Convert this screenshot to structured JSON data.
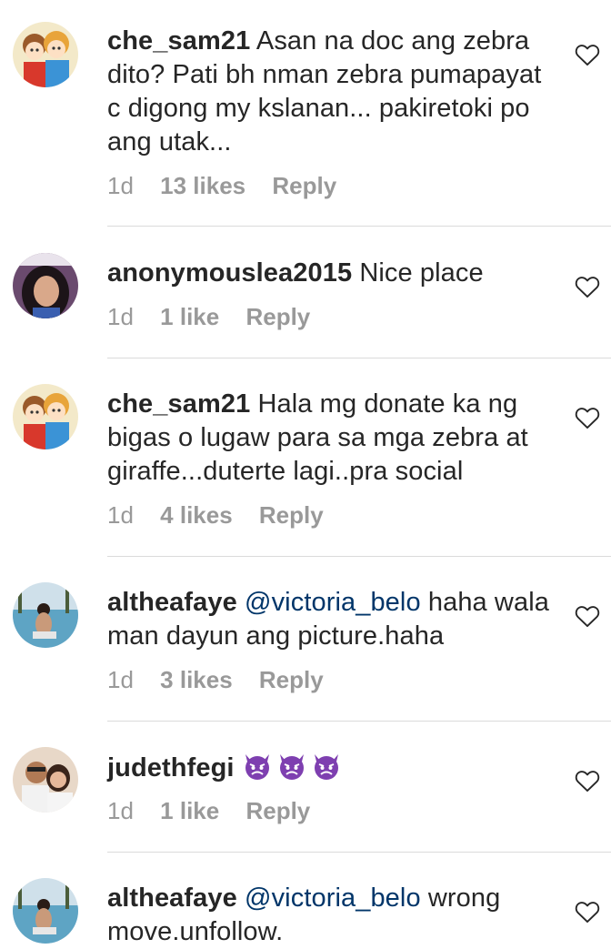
{
  "comments": [
    {
      "username": "che_sam21",
      "text": "Asan na doc ang zebra dito? Pati bh nman zebra pumapayat c digong my kslanan... pakiretoki po ang utak...",
      "time": "1d",
      "likes": "13 likes",
      "reply": "Reply",
      "avatar": "cartoon-couple-avatar",
      "like_icon": "heart-outline-icon"
    },
    {
      "username": "anonymouslea2015",
      "text": "Nice place",
      "time": "1d",
      "likes": "1 like",
      "reply": "Reply",
      "avatar": "woman-portrait-avatar",
      "like_icon": "heart-outline-icon"
    },
    {
      "username": "che_sam21",
      "text": "Hala mg donate ka ng bigas o lugaw para sa mga zebra at giraffe...duterte lagi..pra social",
      "time": "1d",
      "likes": "4 likes",
      "reply": "Reply",
      "avatar": "cartoon-couple-avatar",
      "like_icon": "heart-outline-icon"
    },
    {
      "username": "altheafaye",
      "mention": "@victoria_belo",
      "text": "haha wala man dayun ang picture.haha",
      "time": "1d",
      "likes": "3 likes",
      "reply": "Reply",
      "avatar": "poolside-photo-avatar",
      "like_icon": "heart-outline-icon"
    },
    {
      "username": "judethfegi",
      "emojis": [
        "angry-devil-emoji",
        "angry-devil-emoji",
        "angry-devil-emoji"
      ],
      "time": "1d",
      "likes": "1 like",
      "reply": "Reply",
      "avatar": "couple-photo-avatar",
      "like_icon": "heart-outline-icon"
    },
    {
      "username": "altheafaye",
      "mention": "@victoria_belo",
      "text": "wrong move.unfollow.",
      "avatar": "poolside-photo-avatar",
      "like_icon": "heart-outline-icon"
    }
  ],
  "colors": {
    "text": "#262626",
    "meta": "#999999",
    "mention": "#003569",
    "divider": "#dbdbdb",
    "emoji_purple": "#7e3fb0"
  }
}
